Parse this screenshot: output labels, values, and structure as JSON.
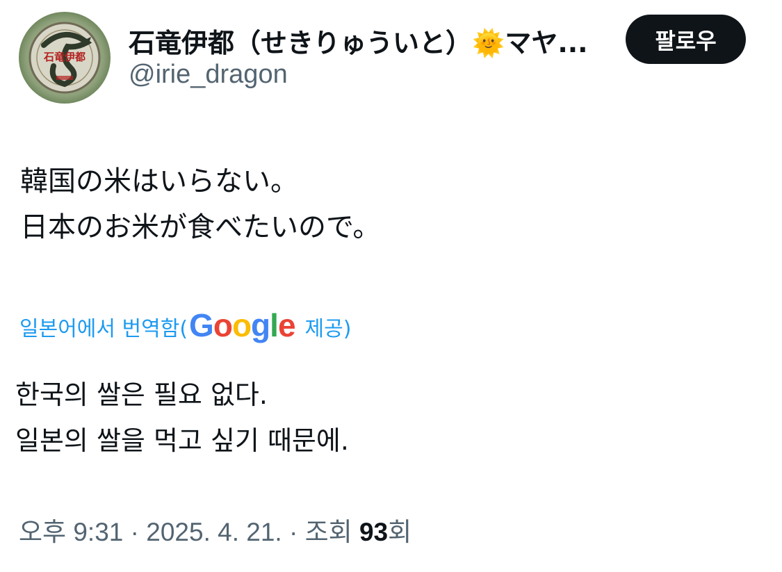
{
  "author": {
    "display_name": "石竜伊都（せきりゅういと）🌞マヤ...",
    "handle": "@irie_dragon",
    "avatar_text": "石竜伊都",
    "avatar_icon": "dragon-emblem"
  },
  "follow_button": {
    "label": "팔로우"
  },
  "tweet": {
    "lines": [
      "韓国の米はいらない。",
      "日本のお米が食べたいので。"
    ]
  },
  "translation": {
    "prefix": "일본어에서 번역함(",
    "google_letters": [
      "G",
      "o",
      "o",
      "g",
      "l",
      "e"
    ],
    "google_colors": [
      "#4285F4",
      "#EA4335",
      "#FBBC05",
      "#4285F4",
      "#34A853",
      "#EA4335"
    ],
    "suffix": "제공)",
    "lines": [
      "한국의 쌀은 필요 없다.",
      "일본의 쌀을 먹고 싶기 때문에."
    ]
  },
  "meta": {
    "time": "오후 9:31",
    "separator1": " · ",
    "date": "2025. 4. 21.",
    "separator2": " · ",
    "views_label": "조회 ",
    "views_count": "93",
    "views_suffix": "회"
  }
}
